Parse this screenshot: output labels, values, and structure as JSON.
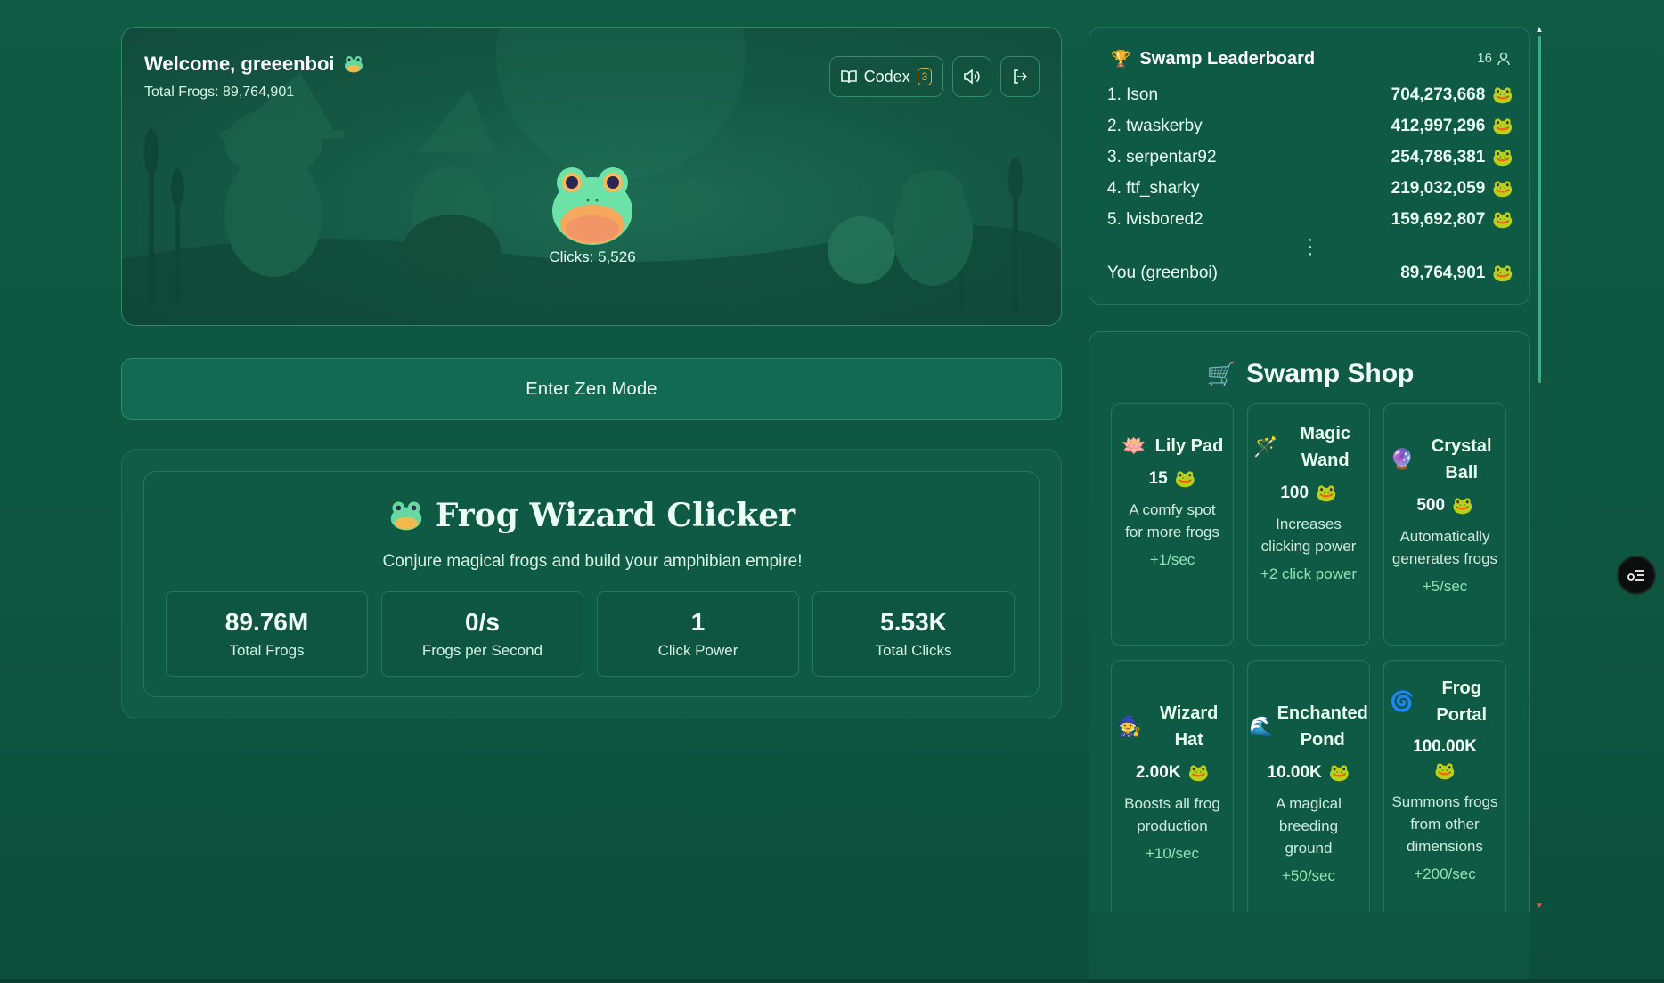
{
  "hero": {
    "welcome": "Welcome, greeenboi",
    "total_frogs": "Total Frogs: 89,764,901",
    "codex_label": "Codex",
    "codex_count": "3",
    "clicks": "Clicks: 5,526"
  },
  "zen": {
    "label": "Enter Zen Mode"
  },
  "game": {
    "title": "Frog Wizard Clicker",
    "subtitle": "Conjure magical frogs and build your amphibian empire!",
    "stats": [
      {
        "value": "89.76M",
        "label": "Total Frogs"
      },
      {
        "value": "0/s",
        "label": "Frogs per Second"
      },
      {
        "value": "1",
        "label": "Click Power"
      },
      {
        "value": "5.53K",
        "label": "Total Clicks"
      }
    ]
  },
  "leaderboard": {
    "title": "Swamp Leaderboard",
    "count": "16",
    "rows": [
      {
        "name": "1. Ison",
        "score": "704,273,668"
      },
      {
        "name": "2. twaskerby",
        "score": "412,997,296"
      },
      {
        "name": "3. serpentar92",
        "score": "254,786,381"
      },
      {
        "name": "4. ftf_sharky",
        "score": "219,032,059"
      },
      {
        "name": "5. lvisbored2",
        "score": "159,692,807"
      }
    ],
    "you": {
      "name": "You (greenboi)",
      "score": "89,764,901"
    }
  },
  "shop": {
    "title": "Swamp Shop",
    "items": [
      {
        "name": "Lily Pad",
        "price": "15",
        "desc": "A comfy spot for more frogs",
        "effect": "+1/sec",
        "icon": "lily-pad-icon"
      },
      {
        "name": "Magic Wand",
        "price": "100",
        "desc": "Increases clicking power",
        "effect": "+2 click power",
        "icon": "magic-wand-icon"
      },
      {
        "name": "Crystal Ball",
        "price": "500",
        "desc": "Automatically generates frogs",
        "effect": "+5/sec",
        "icon": "crystal-ball-icon"
      },
      {
        "name": "Wizard Hat",
        "price": "2.00K",
        "desc": "Boosts all frog production",
        "effect": "+10/sec",
        "icon": "wizard-hat-icon"
      },
      {
        "name": "Enchanted Pond",
        "price": "10.00K",
        "desc": "A magical breeding ground",
        "effect": "+50/sec",
        "icon": "pond-wave-icon"
      },
      {
        "name": "Frog Portal",
        "price": "100.00K",
        "desc": "Summons frogs from other dimensions",
        "effect": "+200/sec",
        "icon": "portal-swirl-icon"
      }
    ]
  },
  "colors": {
    "accent": "#31b387",
    "background": "#0f5a42",
    "gold": "#e0b13a"
  }
}
